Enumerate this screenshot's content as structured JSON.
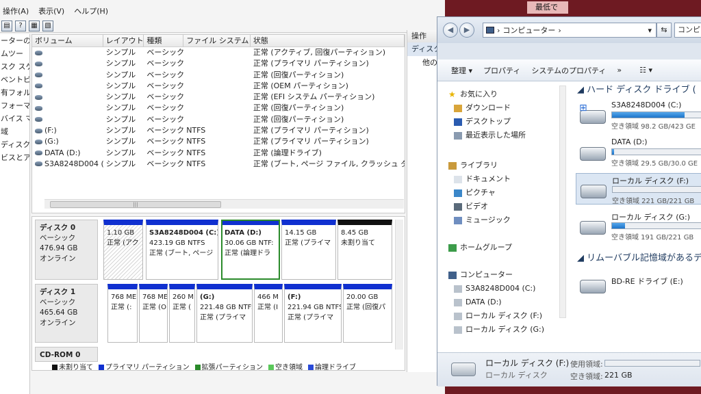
{
  "dm": {
    "menu": [
      "操作(A)",
      "表示(V)",
      "ヘルプ(H)"
    ],
    "tree_items": [
      "ーターの",
      "ムツー",
      "スク スケ",
      "ベントビ",
      "有フォル",
      "フォーマ",
      "バイス マ",
      "域",
      "ディスクの",
      "ビスとア"
    ],
    "columns": [
      "ボリューム",
      "レイアウト",
      "種類",
      "ファイル システム",
      "状態"
    ],
    "volumes": [
      {
        "name": "",
        "layout": "シンプル",
        "type": "ベーシック",
        "fs": "",
        "status": "正常 (アクティブ, 回復パーティション)"
      },
      {
        "name": "",
        "layout": "シンプル",
        "type": "ベーシック",
        "fs": "",
        "status": "正常 (プライマリ パーティション)"
      },
      {
        "name": "",
        "layout": "シンプル",
        "type": "ベーシック",
        "fs": "",
        "status": "正常 (回復パーティション)"
      },
      {
        "name": "",
        "layout": "シンプル",
        "type": "ベーシック",
        "fs": "",
        "status": "正常 (OEM パーティション)"
      },
      {
        "name": "",
        "layout": "シンプル",
        "type": "ベーシック",
        "fs": "",
        "status": "正常 (EFI システム パーティション)"
      },
      {
        "name": "",
        "layout": "シンプル",
        "type": "ベーシック",
        "fs": "",
        "status": "正常 (回復パーティション)"
      },
      {
        "name": "",
        "layout": "シンプル",
        "type": "ベーシック",
        "fs": "",
        "status": "正常 (回復パーティション)"
      },
      {
        "name": "(F:)",
        "layout": "シンプル",
        "type": "ベーシック",
        "fs": "NTFS",
        "status": "正常 (プライマリ パーティション)"
      },
      {
        "name": "(G:)",
        "layout": "シンプル",
        "type": "ベーシック",
        "fs": "NTFS",
        "status": "正常 (プライマリ パーティション)"
      },
      {
        "name": "DATA (D:)",
        "layout": "シンプル",
        "type": "ベーシック",
        "fs": "NTFS",
        "status": "正常 (論理ドライブ)"
      },
      {
        "name": "S3A8248D004 (C:)",
        "layout": "シンプル",
        "type": "ベーシック",
        "fs": "NTFS",
        "status": "正常 (ブート, ページ ファイル, クラッシュ ダ"
      }
    ],
    "disk0": {
      "name": "ディスク 0",
      "type": "ベーシック",
      "size": "476.94 GB",
      "state": "オンライン"
    },
    "disk0_parts": [
      {
        "name": "",
        "size": "1.10 GB",
        "status": "正常 (アク"
      },
      {
        "name": "S3A8248D004 (C:)",
        "size": "423.19 GB NTFS",
        "status": "正常 (ブート, ページ"
      },
      {
        "name": "DATA (D:)",
        "size": "30.06 GB NTF:",
        "status": "正常 (論理ドラ"
      },
      {
        "name": "",
        "size": "14.15 GB",
        "status": "正常 (プライマ"
      },
      {
        "name": "",
        "size": "8.45 GB",
        "status": "未割り当て"
      }
    ],
    "disk1": {
      "name": "ディスク 1",
      "type": "ベーシック",
      "size": "465.64 GB",
      "state": "オンライン"
    },
    "disk1_parts": [
      {
        "name": "",
        "size": "768 ME",
        "status": "正常 (:"
      },
      {
        "name": "",
        "size": "768 ME",
        "status": "正常 (O"
      },
      {
        "name": "",
        "size": "260 M",
        "status": "正常 ("
      },
      {
        "name": "(G:)",
        "size": "221.48 GB NTFS",
        "status": "正常 (プライマ"
      },
      {
        "name": "",
        "size": "466 M",
        "status": "正常 (I"
      },
      {
        "name": "(F:)",
        "size": "221.94 GB NTFS",
        "status": "正常 (プライマ"
      },
      {
        "name": "",
        "size": "20.00 GB",
        "status": "正常 (回復パ"
      }
    ],
    "cdrom": "CD-ROM 0",
    "legend": [
      {
        "label": "未割り当て",
        "color": "#111111"
      },
      {
        "label": "プライマリ パーティション",
        "color": "#1030d0"
      },
      {
        "label": "拡張パーティション",
        "color": "#2a8a2a"
      },
      {
        "label": "空き領域",
        "color": "#5ac85a"
      },
      {
        "label": "論理ドライブ",
        "color": "#2a4ad8"
      }
    ],
    "actions_title": "操作",
    "actions_item": "ディスク",
    "actions_other": "他の"
  },
  "notif": "最低で",
  "ex": {
    "address": "コンピューター",
    "search": "コンピ",
    "cmd": [
      "整理 ▾",
      "プロパティ",
      "システムのプロパティ",
      "»"
    ],
    "nav": [
      {
        "label": "お気に入り",
        "icon": "star-icon"
      },
      {
        "label": "ダウンロード",
        "icon": "download-folder-icon"
      },
      {
        "label": "デスクトップ",
        "icon": "desktop-icon"
      },
      {
        "label": "最近表示した場所",
        "icon": "recent-places-icon"
      },
      {
        "label": "ライブラリ",
        "icon": "library-icon"
      },
      {
        "label": "ドキュメント",
        "icon": "documents-icon"
      },
      {
        "label": "ピクチャ",
        "icon": "pictures-icon"
      },
      {
        "label": "ビデオ",
        "icon": "videos-icon"
      },
      {
        "label": "ミュージック",
        "icon": "music-icon"
      },
      {
        "label": "ホームグループ",
        "icon": "homegroup-icon"
      },
      {
        "label": "コンピューター",
        "icon": "computer-icon"
      },
      {
        "label": "S3A8248D004 (C:)",
        "icon": "drive-icon"
      },
      {
        "label": "DATA (D:)",
        "icon": "drive-icon"
      },
      {
        "label": "ローカル ディスク (F:)",
        "icon": "drive-icon"
      },
      {
        "label": "ローカル ディスク (G:)",
        "icon": "drive-icon"
      }
    ],
    "group_hdd": "ハード ディスク ドライブ (",
    "drives": [
      {
        "name": "S3A8248D004 (C:)",
        "free": "空き領域 98.2 GB/423 GE",
        "used": 0.77
      },
      {
        "name": "DATA (D:)",
        "free": "空き領域 29.5 GB/30.0 GE",
        "used": 0.02
      },
      {
        "name": "ローカル ディスク (F:)",
        "free": "空き領域 221 GB/221 GB",
        "used": 0.0
      },
      {
        "name": "ローカル ディスク (G:)",
        "free": "空き領域 191 GB/221 GB",
        "used": 0.14
      }
    ],
    "group_removable": "リムーバブル記憶域があるデ",
    "bd_drive": "BD-RE ドライブ (E:)",
    "details": {
      "name": "ローカル ディスク (F:)",
      "type": "ローカル ディスク",
      "used_label": "使用領域:",
      "free_label": "空き領域:",
      "free_value": "221 GB"
    }
  }
}
